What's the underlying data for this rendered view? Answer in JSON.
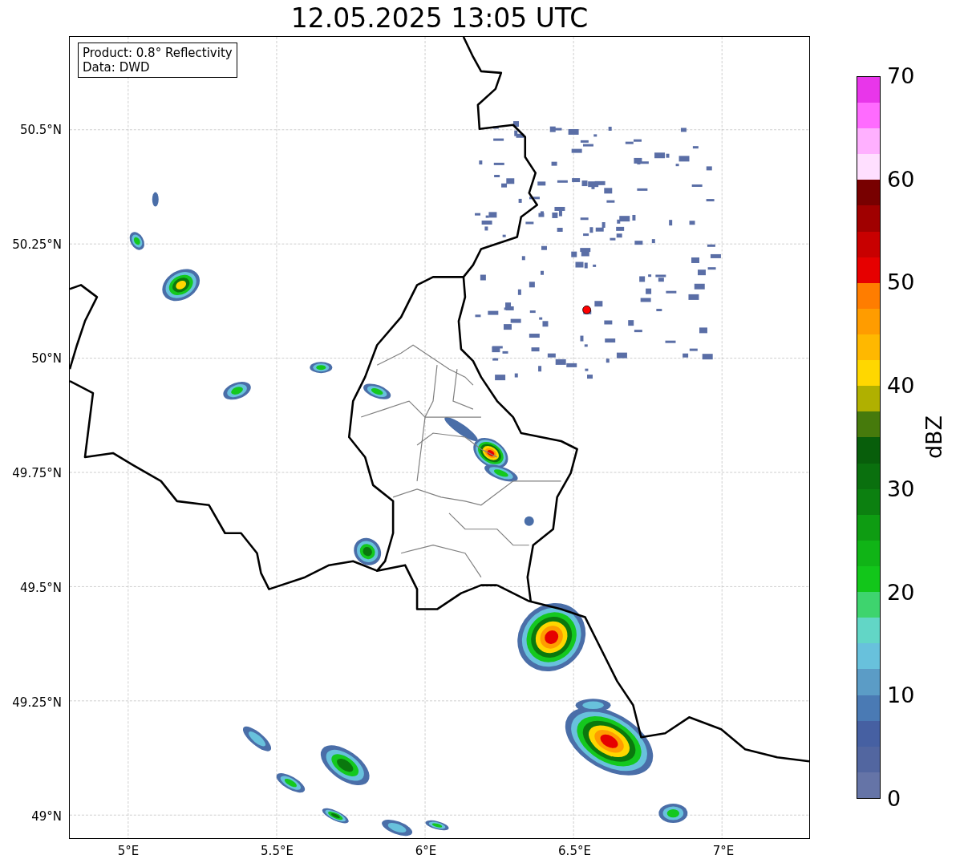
{
  "title": "12.05.2025 13:05 UTC",
  "info_box": {
    "lines": [
      "Product: 0.8° Reflectivity",
      "Data: DWD"
    ]
  },
  "map": {
    "lat_labels": [
      "50.5°N",
      "50.25°N",
      "50°N",
      "49.75°N",
      "49.5°N",
      "49.25°N",
      "49°N"
    ],
    "lon_labels": [
      "5°E",
      "5.5°E",
      "6°E",
      "6.5°E",
      "7°E"
    ]
  },
  "colorbar": {
    "label": "dBZ",
    "ticks": [
      "70",
      "60",
      "50",
      "40",
      "30",
      "20",
      "10",
      "0"
    ],
    "segments": [
      {
        "color": "#6574a7"
      },
      {
        "color": "#5266a0"
      },
      {
        "color": "#4660a2"
      },
      {
        "color": "#4a7ab4"
      },
      {
        "color": "#5b9cc6"
      },
      {
        "color": "#68c1dc"
      },
      {
        "color": "#62d6c6"
      },
      {
        "color": "#3ed46e"
      },
      {
        "color": "#12c61a"
      },
      {
        "color": "#10b416"
      },
      {
        "color": "#0e9c12"
      },
      {
        "color": "#0c8010"
      },
      {
        "color": "#0a700e"
      },
      {
        "color": "#085e0b"
      },
      {
        "color": "#467a0c"
      },
      {
        "color": "#b0b000"
      },
      {
        "color": "#ffd700"
      },
      {
        "color": "#ffb800"
      },
      {
        "color": "#ff9c00"
      },
      {
        "color": "#ff7d00"
      },
      {
        "color": "#e60000"
      },
      {
        "color": "#c80000"
      },
      {
        "color": "#a00000"
      },
      {
        "color": "#780000"
      },
      {
        "color": "#ffdfff"
      },
      {
        "color": "#ffb0ff"
      },
      {
        "color": "#ff6bff"
      },
      {
        "color": "#e836ea"
      }
    ]
  }
}
